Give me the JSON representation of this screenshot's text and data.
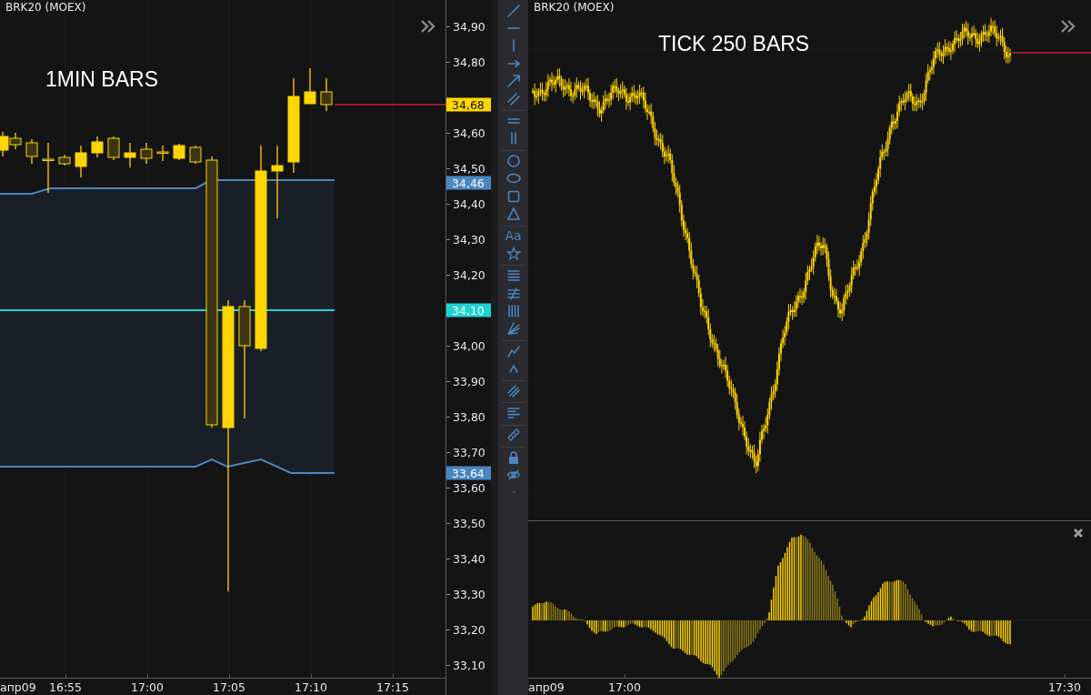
{
  "left_chart": {
    "symbol": "BRK20 (MOEX)",
    "caption": "1MIN BARS"
  },
  "price_axis": {
    "ticks": [
      "34,90",
      "34,80",
      "34,60",
      "34,50",
      "34,40",
      "34,30",
      "34,20",
      "34,00",
      "33,90",
      "33,80",
      "33,70",
      "33,60",
      "33,50",
      "33,40",
      "33,30",
      "33,20",
      "33,10"
    ],
    "markers": [
      {
        "label": "34,68",
        "color": "#ffd700"
      },
      {
        "label": "34,46",
        "color": "#4a86c0"
      },
      {
        "label": "34,10",
        "color": "#1fd3d3"
      },
      {
        "label": "33,64",
        "color": "#4a86c0"
      }
    ]
  },
  "left_time_axis": {
    "date": "апр09",
    "times": [
      "16:55",
      "17:00",
      "17:05",
      "17:10",
      "17:15"
    ]
  },
  "toolbar": {
    "groups": [
      [
        {
          "kind": "trend-line"
        },
        {
          "kind": "horizontal-line"
        },
        {
          "kind": "vertical-line"
        },
        {
          "kind": "ray"
        },
        {
          "kind": "arrow"
        },
        {
          "kind": "channel"
        }
      ],
      [
        {
          "kind": "double-horizontal"
        },
        {
          "kind": "double-vertical"
        }
      ],
      [
        {
          "kind": "circle"
        },
        {
          "kind": "ellipse"
        },
        {
          "kind": "rectangle"
        },
        {
          "kind": "triangle"
        }
      ],
      [
        {
          "kind": "text",
          "label": "Aa"
        },
        {
          "kind": "star"
        }
      ],
      [
        {
          "kind": "horizontal-lines"
        },
        {
          "kind": "crossed-lines"
        },
        {
          "kind": "vertical-lines"
        },
        {
          "kind": "fan"
        }
      ],
      [
        {
          "kind": "polyline"
        },
        {
          "kind": "caret"
        }
      ],
      [
        {
          "kind": "hatch"
        }
      ],
      [
        {
          "kind": "align-lines"
        }
      ],
      [
        {
          "kind": "ruler"
        }
      ],
      [
        {
          "kind": "lock"
        },
        {
          "kind": "eye-off"
        },
        {
          "kind": "more"
        }
      ]
    ]
  },
  "right_chart": {
    "symbol": "BRK20 (MOEX)",
    "caption": "TICK 250 BARS"
  },
  "right_time_axis": {
    "date": "апр09",
    "times": [
      "17:00",
      "17:30"
    ]
  }
}
